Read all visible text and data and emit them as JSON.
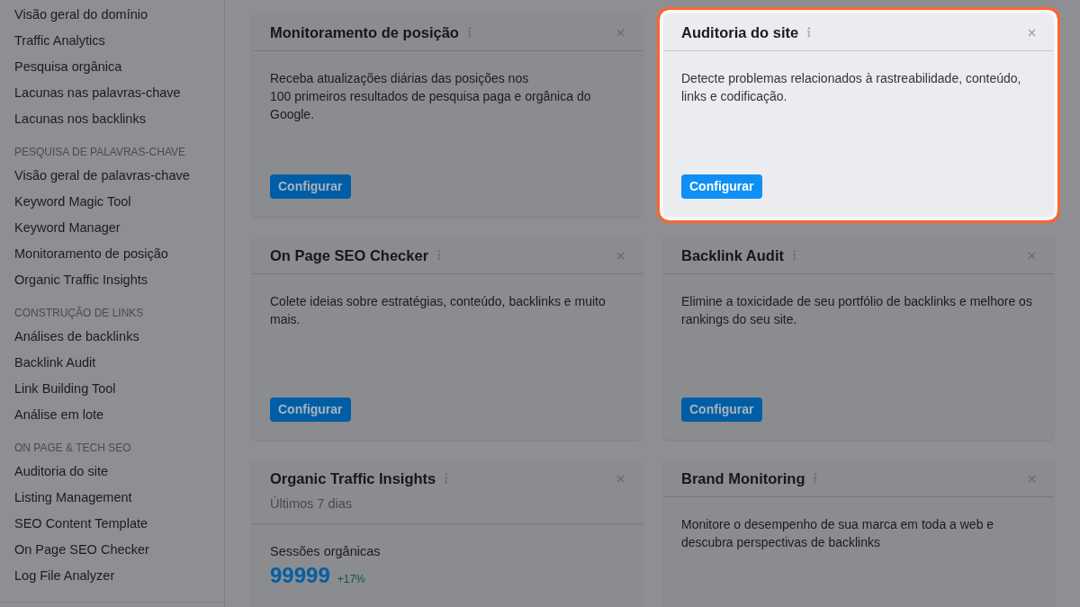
{
  "sidebar": {
    "items": [
      {
        "kind": "link",
        "label": "Visão geral do domínio"
      },
      {
        "kind": "link",
        "label": "Traffic Analytics"
      },
      {
        "kind": "link",
        "label": "Pesquisa orgânica"
      },
      {
        "kind": "link",
        "label": "Lacunas nas palavras-chave"
      },
      {
        "kind": "link",
        "label": "Lacunas nos backlinks"
      },
      {
        "kind": "header",
        "label": "PESQUISA DE PALAVRAS-CHAVE"
      },
      {
        "kind": "link",
        "label": "Visão geral de palavras-chave"
      },
      {
        "kind": "link",
        "label": "Keyword Magic Tool"
      },
      {
        "kind": "link",
        "label": "Keyword Manager"
      },
      {
        "kind": "link",
        "label": "Monitoramento de posição"
      },
      {
        "kind": "link",
        "label": "Organic Traffic Insights"
      },
      {
        "kind": "header",
        "label": "CONSTRUÇÃO DE LINKS"
      },
      {
        "kind": "link",
        "label": "Análises de backlinks"
      },
      {
        "kind": "link",
        "label": "Backlink Audit"
      },
      {
        "kind": "link",
        "label": "Link Building Tool"
      },
      {
        "kind": "link",
        "label": "Análise em lote"
      },
      {
        "kind": "header",
        "label": "ON PAGE & TECH SEO"
      },
      {
        "kind": "link",
        "label": "Auditoria do site"
      },
      {
        "kind": "link",
        "label": "Listing Management"
      },
      {
        "kind": "link",
        "label": "SEO Content Template"
      },
      {
        "kind": "link",
        "label": "On Page SEO Checker"
      },
      {
        "kind": "link",
        "label": "Log File Analyzer"
      }
    ]
  },
  "cards": [
    {
      "kind": "setup",
      "title": "Monitoramento de posição",
      "highlighted": false,
      "description": "Receba atualizações diárias das posições nos\n100 primeiros resultados de pesquisa paga e orgânica do Google.",
      "button": "Configurar"
    },
    {
      "kind": "setup",
      "title": "Auditoria do site",
      "highlighted": true,
      "description": "Detecte problemas relacionados à rastreabilidade, conteúdo, links e codificação.",
      "button": "Configurar"
    },
    {
      "kind": "setup",
      "title": "On Page SEO Checker",
      "highlighted": false,
      "description": "Colete ideias sobre estratégias, conteúdo, backlinks e muito mais.",
      "button": "Configurar"
    },
    {
      "kind": "setup",
      "title": "Backlink Audit",
      "highlighted": false,
      "description": "Elimine a toxicidade de seu portfólio de backlinks e melhore os rankings do seu site.",
      "button": "Configurar"
    },
    {
      "kind": "metric",
      "title": "Organic Traffic Insights",
      "highlighted": false,
      "subtitle": "Últimos 7 dias",
      "metric_label": "Sessões orgânicas",
      "metric_value": "99999",
      "metric_change": "+17%"
    },
    {
      "kind": "setup",
      "title": "Brand Monitoring",
      "highlighted": false,
      "description": "Monitore o desempenho de sua marca em toda a web e descubra perspectivas de backlinks"
    }
  ]
}
